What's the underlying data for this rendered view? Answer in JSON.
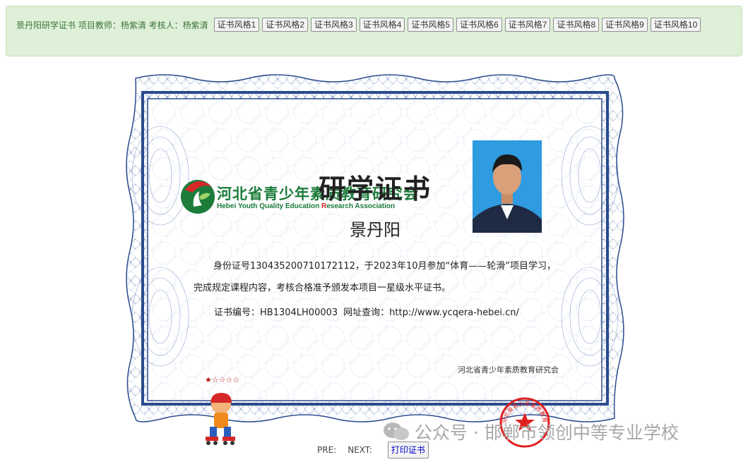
{
  "toolbar": {
    "info_text": "景丹阳研学证书   项目教师：杨紫清  考核人：杨紫清",
    "style_buttons": [
      "证书风格1",
      "证书风格2",
      "证书风格3",
      "证书风格4",
      "证书风格5",
      "证书风格6",
      "证书风格7",
      "证书风格8",
      "证书风格9",
      "证书风格10"
    ]
  },
  "certificate": {
    "org_name_cn": "河北省青少年素质教育研究会",
    "org_name_en_parts": [
      "Hebei Youth Quality Education ",
      "R",
      "esearch Association"
    ],
    "title": "研学证书",
    "student_name": "景丹阳",
    "body": "身份证号130435200710172112，于2023年10月参加“体育——轮滑”项目学习，完成规定课程内容，考核合格准予颁发本项目一星级水平证书。",
    "cert_number_label": "证书编号：HB1304LH00003",
    "website_label": "网址查询：http://www.ycqera-hebei.cn/",
    "stars_earned": 1,
    "stars_total": 5,
    "star_filled": "★",
    "star_empty": "☆",
    "org_signature": "河北省青少年素质教育研究会",
    "seal_text": "河北省青少年素质教育研究会"
  },
  "watermark": {
    "text": "公众号 · 邯郸市领创中等专业学校"
  },
  "pager": {
    "pre_label": "PRE:",
    "next_label": "NEXT:",
    "print_label": "打印证书"
  },
  "colors": {
    "toolbar_bg": "#dff0d8",
    "toolbar_text": "#3c763d",
    "frame_blue": "#2a4b8c",
    "logo_green": "#1c7c3a",
    "seal_red": "#e02020",
    "photo_bg": "#2f9be0"
  }
}
